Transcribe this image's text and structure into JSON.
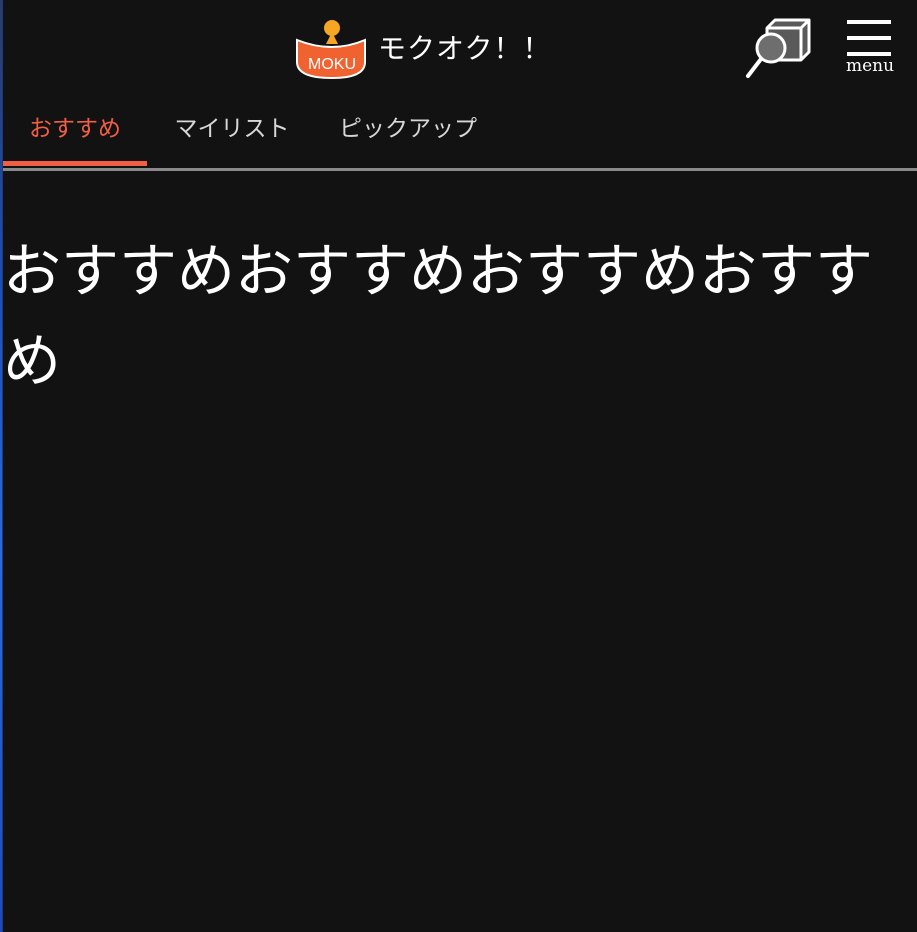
{
  "header": {
    "logo_text": "MOKU",
    "site_title": "モクオク！！",
    "menu_label": "menu",
    "search_icon": "search-product-icon",
    "menu_icon": "hamburger-icon"
  },
  "tabs": [
    {
      "label": "おすすめ",
      "active": true
    },
    {
      "label": "マイリスト",
      "active": false
    },
    {
      "label": "ピックアップ",
      "active": false
    }
  ],
  "content": {
    "text": "おすすめおすすめおすすめおすすめ"
  },
  "colors": {
    "background": "#121212",
    "accent": "#f05f45",
    "logo_orange": "#f0622f",
    "logo_yellow": "#f5a623",
    "tab_inactive": "#d7d7d7",
    "divider": "#8a8a8a"
  }
}
